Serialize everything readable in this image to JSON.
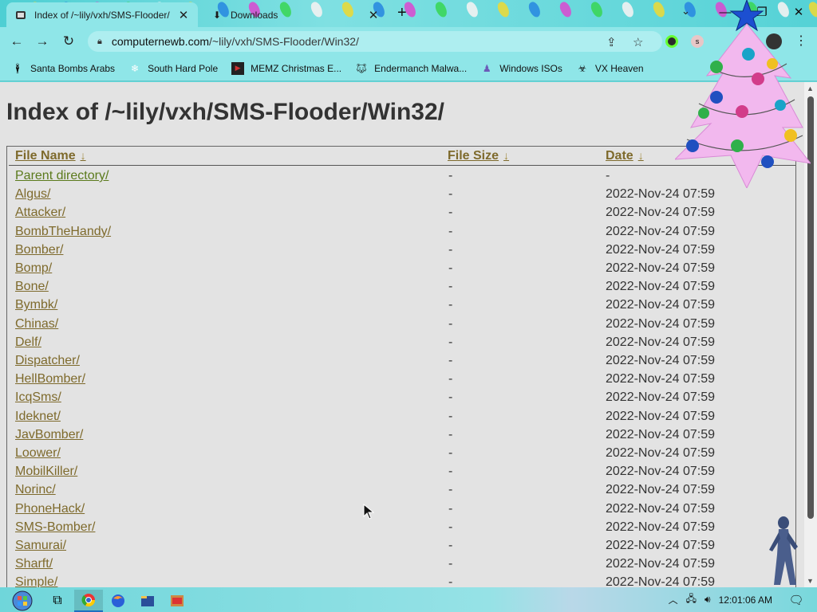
{
  "browser": {
    "tabs": [
      {
        "title": "Index of /~lily/vxh/SMS-Flooder/",
        "active": true
      },
      {
        "title": "Downloads",
        "active": false
      }
    ],
    "new_tab": "+",
    "tab_search": "⌄",
    "window_buttons": {
      "minimize": "—",
      "maximize": "❐",
      "close": "✕"
    },
    "nav": {
      "back": "←",
      "forward": "→",
      "reload": "↻"
    },
    "url_host": "computernewb.com",
    "url_path": "/~lily/vxh/SMS-Flooder/Win32/",
    "bookmarks": [
      {
        "label": "Santa Bombs Arabs",
        "icon": "figure-icon"
      },
      {
        "label": "South Hard Pole",
        "icon": "snowflake-icon"
      },
      {
        "label": "MEMZ Christmas E...",
        "icon": "video-icon"
      },
      {
        "label": "Endermanch Malwa...",
        "icon": "wolf-icon"
      },
      {
        "label": "Windows ISOs",
        "icon": "windows-icon"
      },
      {
        "label": "VX Heaven",
        "icon": "biohazard-icon"
      }
    ]
  },
  "page": {
    "title": "Index of /~lily/vxh/SMS-Flooder/Win32/",
    "columns": {
      "name": "File Name",
      "size": "File Size",
      "date": "Date",
      "sort_arrow": "↓"
    },
    "rows": [
      {
        "name": "Parent directory/",
        "size": "-",
        "date": "-"
      },
      {
        "name": "Algus/",
        "size": "-",
        "date": "2022-Nov-24 07:59"
      },
      {
        "name": "Attacker/",
        "size": "-",
        "date": "2022-Nov-24 07:59"
      },
      {
        "name": "BombTheHandy/",
        "size": "-",
        "date": "2022-Nov-24 07:59"
      },
      {
        "name": "Bomber/",
        "size": "-",
        "date": "2022-Nov-24 07:59"
      },
      {
        "name": "Bomp/",
        "size": "-",
        "date": "2022-Nov-24 07:59"
      },
      {
        "name": "Bone/",
        "size": "-",
        "date": "2022-Nov-24 07:59"
      },
      {
        "name": "Bymbk/",
        "size": "-",
        "date": "2022-Nov-24 07:59"
      },
      {
        "name": "Chinas/",
        "size": "-",
        "date": "2022-Nov-24 07:59"
      },
      {
        "name": "Delf/",
        "size": "-",
        "date": "2022-Nov-24 07:59"
      },
      {
        "name": "Dispatcher/",
        "size": "-",
        "date": "2022-Nov-24 07:59"
      },
      {
        "name": "HellBomber/",
        "size": "-",
        "date": "2022-Nov-24 07:59"
      },
      {
        "name": "IcqSms/",
        "size": "-",
        "date": "2022-Nov-24 07:59"
      },
      {
        "name": "Ideknet/",
        "size": "-",
        "date": "2022-Nov-24 07:59"
      },
      {
        "name": "JavBomber/",
        "size": "-",
        "date": "2022-Nov-24 07:59"
      },
      {
        "name": "Loower/",
        "size": "-",
        "date": "2022-Nov-24 07:59"
      },
      {
        "name": "MobilKiller/",
        "size": "-",
        "date": "2022-Nov-24 07:59"
      },
      {
        "name": "Norinc/",
        "size": "-",
        "date": "2022-Nov-24 07:59"
      },
      {
        "name": "PhoneHack/",
        "size": "-",
        "date": "2022-Nov-24 07:59"
      },
      {
        "name": "SMS-Bomber/",
        "size": "-",
        "date": "2022-Nov-24 07:59"
      },
      {
        "name": "Samurai/",
        "size": "-",
        "date": "2022-Nov-24 07:59"
      },
      {
        "name": "Sharft/",
        "size": "-",
        "date": "2022-Nov-24 07:59"
      },
      {
        "name": "Simple/",
        "size": "-",
        "date": "2022-Nov-24 07:59"
      }
    ]
  },
  "taskbar": {
    "pinned": [
      "start-orb-icon",
      "task-view-icon",
      "chrome-icon",
      "firefox-icon",
      "file-explorer-icon",
      "terminal-icon"
    ],
    "clock": "12:01:06 AM"
  },
  "colors": {
    "link": "#7e6a2c",
    "page_bg": "#e3e3e3",
    "chrome_accent": "#8fe6e8"
  }
}
